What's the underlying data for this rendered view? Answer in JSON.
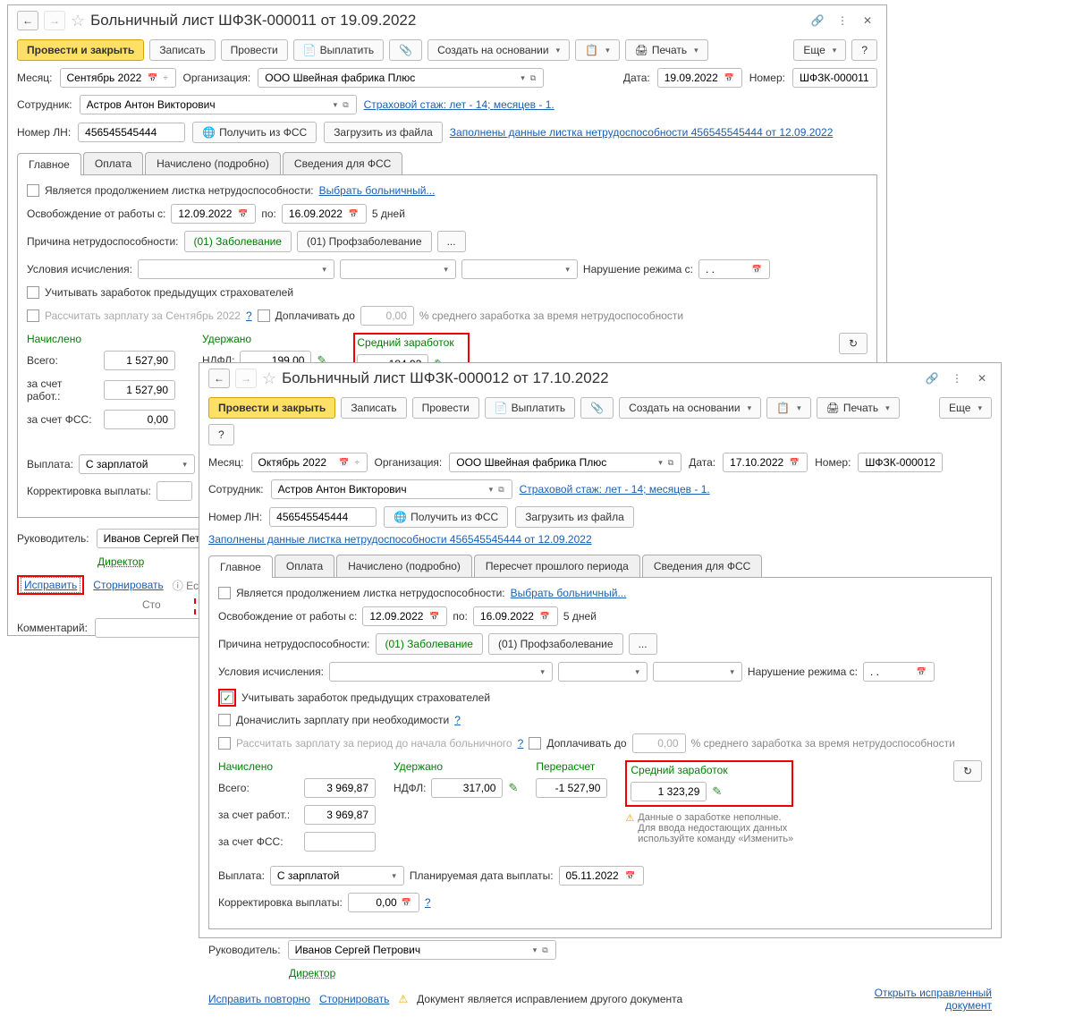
{
  "w1": {
    "title": "Больничный лист ШФЗК-000011 от 19.09.2022",
    "toolbar": {
      "post_close": "Провести и закрыть",
      "save": "Записать",
      "post": "Провести",
      "pay": "Выплатить",
      "create_based": "Создать на основании",
      "print": "Печать",
      "more": "Еще",
      "help": "?"
    },
    "fields": {
      "month_lbl": "Месяц:",
      "month": "Сентябрь 2022",
      "org_lbl": "Организация:",
      "org": "ООО Швейная фабрика Плюс",
      "date_lbl": "Дата:",
      "date": "19.09.2022",
      "number_lbl": "Номер:",
      "number": "ШФЗК-000011",
      "employee_lbl": "Сотрудник:",
      "employee": "Астров Антон Викторович",
      "stazh": "Страховой стаж: лет - 14; месяцев - 1.",
      "ln_lbl": "Номер ЛН:",
      "ln": "456545545444",
      "from_fss": "Получить из ФСС",
      "from_file": "Загрузить из файла",
      "filled_link": "Заполнены данные листка нетрудоспособности 456545545444 от 12.09.2022"
    },
    "tabs": {
      "main": "Главное",
      "payment": "Оплата",
      "accrued": "Начислено (подробно)",
      "fss": "Сведения для ФСС"
    },
    "main": {
      "continuation_lbl": "Является продолжением листка нетрудоспособности:",
      "choose": "Выбрать больничный...",
      "release_lbl": "Освобождение от работы с:",
      "from": "12.09.2022",
      "to_lbl": "по:",
      "to": "16.09.2022",
      "days": "5 дней",
      "cause_lbl": "Причина нетрудоспособности:",
      "cause1": "(01) Заболевание",
      "cause2": "(01) Профзаболевание",
      "cond_lbl": "Условия исчисления:",
      "violation_lbl": "Нарушение режима с:",
      "violation": ". .",
      "prev_insurers": "Учитывать заработок предыдущих страхователей",
      "recalc": "Рассчитать зарплату за Сентябрь 2022",
      "topup": "Доплачивать до",
      "topup_val": "0,00",
      "topup_hint": "% среднего заработка за время нетрудоспособности",
      "accrued_h": "Начислено",
      "held_h": "Удержано",
      "avg_h": "Средний заработок",
      "total_lbl": "Всего:",
      "total": "1 527,90",
      "ndfl_lbl": "НДФЛ:",
      "ndfl": "199,00",
      "avg": "184,93",
      "by_employer_lbl": "за счет работ.:",
      "by_employer": "1 527,90",
      "by_fss_lbl": "за счет ФСС:",
      "by_fss": "0,00",
      "payout_lbl": "Выплата:",
      "payout": "С зарплатой",
      "correction_lbl": "Корректировка выплаты:"
    },
    "foot": {
      "head_lbl": "Руководитель:",
      "head": "Иванов Сергей Петрович",
      "position": "Директор",
      "fix": "Исправить",
      "storno": "Сторнировать",
      "hint": "Если н",
      "hint2": "Сто",
      "comment_lbl": "Комментарий:"
    }
  },
  "w2": {
    "title": "Больничный лист ШФЗК-000012 от 17.10.2022",
    "toolbar": {
      "post_close": "Провести и закрыть",
      "save": "Записать",
      "post": "Провести",
      "pay": "Выплатить",
      "create_based": "Создать на основании",
      "print": "Печать",
      "more": "Еще",
      "help": "?"
    },
    "fields": {
      "month_lbl": "Месяц:",
      "month": "Октябрь 2022",
      "org_lbl": "Организация:",
      "org": "ООО Швейная фабрика Плюс",
      "date_lbl": "Дата:",
      "date": "17.10.2022",
      "number_lbl": "Номер:",
      "number": "ШФЗК-000012",
      "employee_lbl": "Сотрудник:",
      "employee": "Астров Антон Викторович",
      "stazh": "Страховой стаж: лет - 14; месяцев - 1.",
      "ln_lbl": "Номер ЛН:",
      "ln": "456545545444",
      "from_fss": "Получить из ФСС",
      "from_file": "Загрузить из файла",
      "filled_link": "Заполнены данные листка нетрудоспособности 456545545444 от 12.09.2022"
    },
    "tabs": {
      "main": "Главное",
      "payment": "Оплата",
      "accrued": "Начислено (подробно)",
      "recalc": "Пересчет прошлого периода",
      "fss": "Сведения для ФСС"
    },
    "main": {
      "continuation_lbl": "Является продолжением листка нетрудоспособности:",
      "choose": "Выбрать больничный...",
      "release_lbl": "Освобождение от работы с:",
      "from": "12.09.2022",
      "to_lbl": "по:",
      "to": "16.09.2022",
      "days": "5 дней",
      "cause_lbl": "Причина нетрудоспособности:",
      "cause1": "(01) Заболевание",
      "cause2": "(01) Профзаболевание",
      "cond_lbl": "Условия исчисления:",
      "violation_lbl": "Нарушение режима с:",
      "violation": ". .",
      "prev_insurers": "Учитывать заработок предыдущих страхователей",
      "extra": "Доначислить зарплату при необходимости",
      "recalc": "Рассчитать зарплату за период до начала больничного",
      "topup": "Доплачивать до",
      "topup_val": "0,00",
      "topup_hint": "% среднего заработка за время нетрудоспособности",
      "accrued_h": "Начислено",
      "held_h": "Удержано",
      "recalc_h": "Перерасчет",
      "avg_h": "Средний заработок",
      "total_lbl": "Всего:",
      "total": "3 969,87",
      "ndfl_lbl": "НДФЛ:",
      "ndfl": "317,00",
      "recalc_v": "-1 527,90",
      "avg": "1 323,29",
      "by_employer_lbl": "за счет работ.:",
      "by_employer": "3 969,87",
      "by_fss_lbl": "за счет ФСС:",
      "warn1": "Данные о заработке неполные.",
      "warn2": "Для ввода недостающих данных",
      "warn3": "используйте команду «Изменить»",
      "payout_lbl": "Выплата:",
      "payout": "С зарплатой",
      "plan_lbl": "Планируемая дата выплаты:",
      "plan": "05.11.2022",
      "correction_lbl": "Корректировка выплаты:",
      "correction_v": "0,00"
    },
    "foot": {
      "head_lbl": "Руководитель:",
      "head": "Иванов Сергей Петрович",
      "position": "Директор",
      "fix": "Исправить повторно",
      "storno": "Сторнировать",
      "hint": "Документ является исправлением другого документа",
      "open": "Открыть исправленный документ"
    }
  }
}
